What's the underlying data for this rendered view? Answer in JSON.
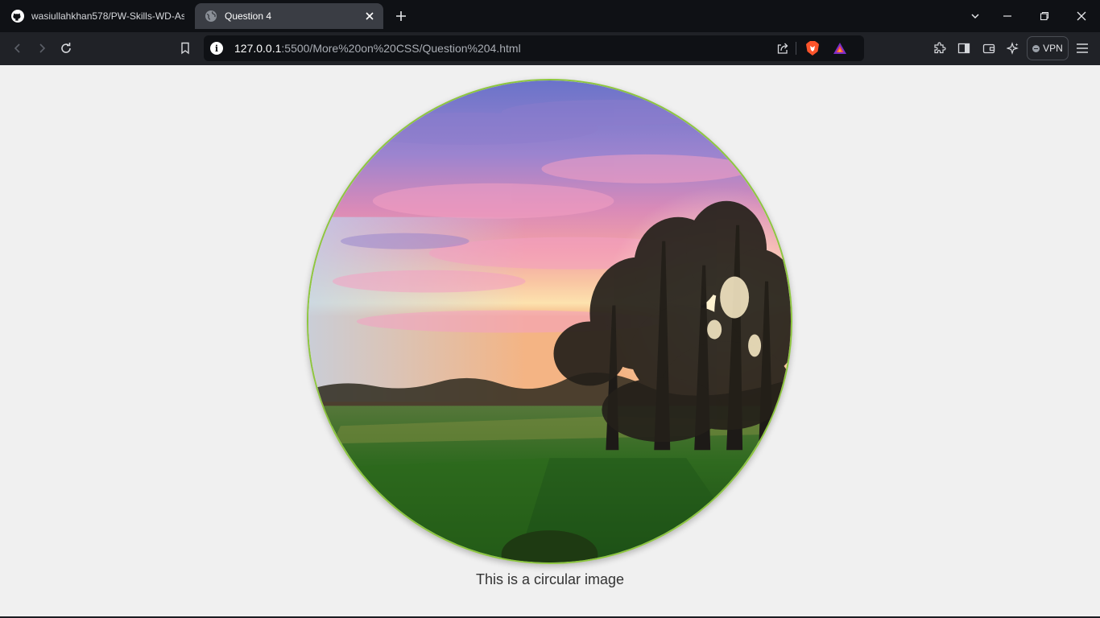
{
  "browser": {
    "tabs": [
      {
        "title": "wasiullahkhan578/PW-Skills-WD-Assignments",
        "icon": "github-icon",
        "active": false
      },
      {
        "title": "Question 4",
        "icon": "globe-icon",
        "active": true
      }
    ],
    "address_bar": {
      "host": "127.0.0.1",
      "path": ":5500/More%20on%20CSS/Question%204.html"
    },
    "vpn_label": "VPN"
  },
  "page": {
    "caption": "This is a circular image",
    "image": {
      "shape": "circle",
      "border_color": "#8dc63f",
      "depicts": "sunset-landscape"
    },
    "background_color": "#f0f0f0"
  }
}
